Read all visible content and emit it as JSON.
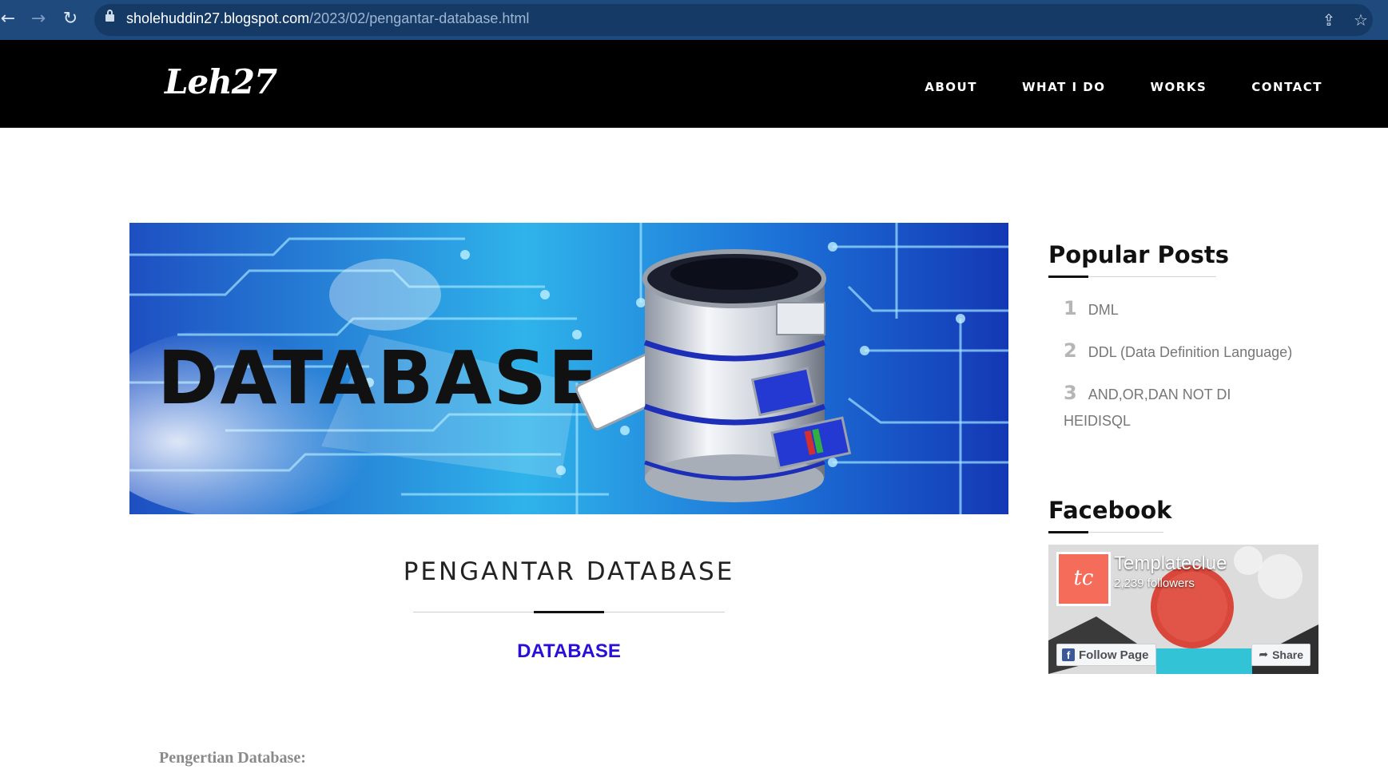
{
  "browser": {
    "url_host": "sholehuddin27.blogspot.com",
    "url_path": "/2023/02/pengantar-database.html",
    "icons": [
      "back-arrow-icon",
      "forward-arrow-icon",
      "reload-icon",
      "lock-icon",
      "share-icon",
      "star-icon"
    ]
  },
  "site": {
    "logo": "Leh27",
    "menu": [
      "ABOUT",
      "WHAT I DO",
      "WORKS",
      "CONTACT"
    ]
  },
  "hero": {
    "text": "DATABASE"
  },
  "post": {
    "title": "PENGANTAR DATABASE",
    "subtitle": "DATABASE",
    "paragraph_heading": "Pengertian Database:"
  },
  "sidebar": {
    "popular_posts": {
      "title": "Popular Posts",
      "items": [
        {
          "num": "1",
          "label": "DML"
        },
        {
          "num": "2",
          "label": "DDL (Data Definition Language)"
        },
        {
          "num": "3",
          "label": "AND,OR,DAN NOT DI HEIDISQL"
        }
      ]
    },
    "facebook": {
      "title": "Facebook",
      "avatar_text": "tc",
      "page_name": "Templateclue",
      "followers": "2,239 followers",
      "follow_label": "Follow Page",
      "share_label": "Share"
    }
  },
  "colors": {
    "chrome": "#1f4a7d",
    "header": "#000000",
    "subtitle": "#2a0edc",
    "facebook_blue": "#3b5998",
    "avatar": "#f56c5a"
  }
}
